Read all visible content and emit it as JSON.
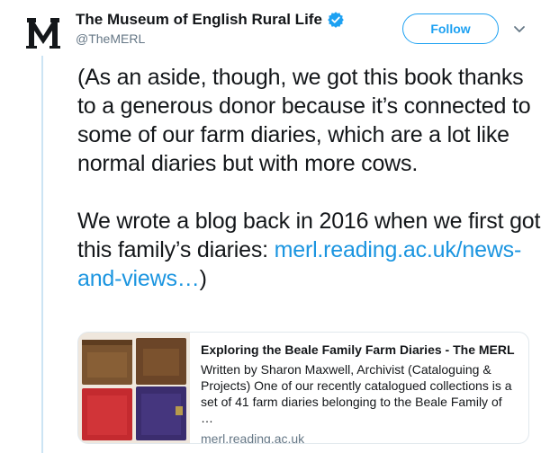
{
  "account": {
    "display_name": "The Museum of English Rural Life",
    "handle": "@TheMERL",
    "avatar_letter": "M",
    "verified_icon": "verified-badge-icon"
  },
  "follow_label": "Follow",
  "tweet": {
    "paragraph1": "(As an aside, though, we got this book thanks to a generous donor because it’s connected to some of our farm diaries, which are a lot like normal diaries but with more cows.",
    "paragraph2_text": "We wrote a blog back in 2016 when we first got this family’s diaries:",
    "link_text": "merl.reading.ac.uk/news-and-views…",
    "paragraph2_end": ")"
  },
  "card": {
    "title": "Exploring the Beale Family Farm Diaries - The MERL",
    "description": "Written by Sharon Maxwell, Archivist (Cataloguing & Projects) One of our recently catalogued collections is a set of 41 farm diaries belonging to the Beale Family of …",
    "domain": "merl.reading.ac.uk"
  },
  "colors": {
    "accent": "#1da1f2",
    "link": "#1b95e0",
    "text": "#14171a",
    "secondary": "#657786",
    "thread_line": "#cce4f4"
  }
}
